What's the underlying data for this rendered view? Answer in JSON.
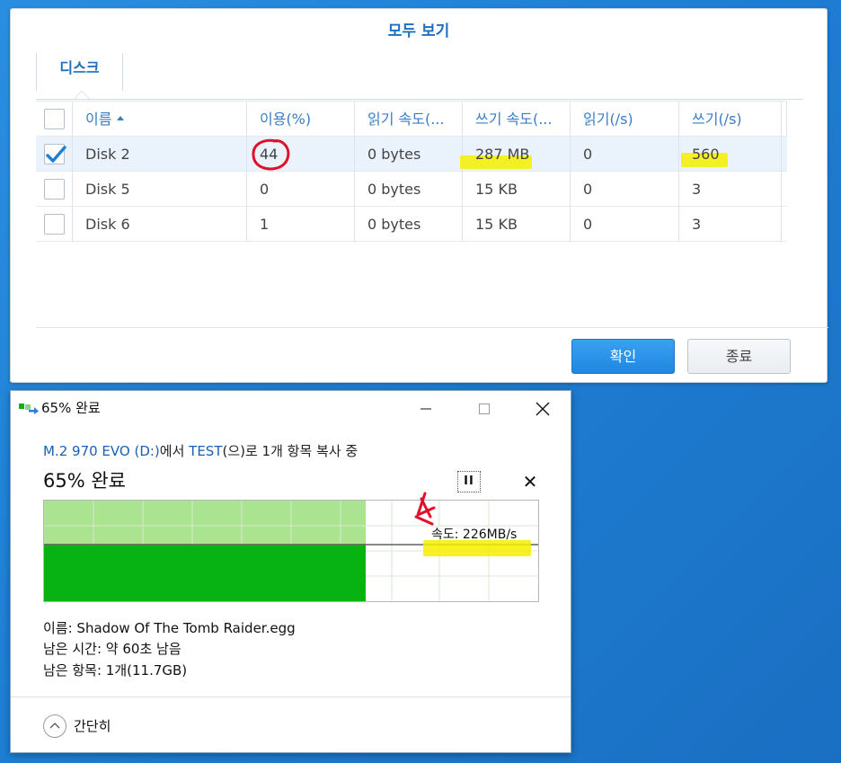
{
  "synology": {
    "title": "모두 보기",
    "tab": "디스크",
    "columns": [
      "이름",
      "이용(%)",
      "읽기 속도(...",
      "쓰기 속도(...",
      "읽기(/s)",
      "쓰기(/s)"
    ],
    "rows": [
      {
        "name": "Disk 2",
        "usage": "44",
        "read_speed": "0 bytes",
        "write_speed": "287 MB",
        "reads": "0",
        "writes": "560",
        "checked": true
      },
      {
        "name": "Disk 5",
        "usage": "0",
        "read_speed": "0 bytes",
        "write_speed": "15 KB",
        "reads": "0",
        "writes": "3",
        "checked": false
      },
      {
        "name": "Disk 6",
        "usage": "1",
        "read_speed": "0 bytes",
        "write_speed": "15 KB",
        "reads": "0",
        "writes": "3",
        "checked": false
      }
    ],
    "ok_label": "확인",
    "close_label": "종료",
    "colors": {
      "accent": "#1c6fc2",
      "button": "#2590e8",
      "highlight": "#f6ee00",
      "annotation": "#e0102a"
    }
  },
  "copy_dialog": {
    "title": "65% 완료",
    "source": "M.2 970 EVO (D:)",
    "source_suffix": "에서 ",
    "dest": "TEST",
    "dest_suffix": "(으)로 1개 항목 복사 중",
    "progress_text": "65% 완료",
    "progress_percent": 65,
    "pause_label": "II",
    "cancel_label": "✕",
    "speed_label": "속도: 226MB/s",
    "name_line": "이름: Shadow Of The Tomb Raider.egg",
    "time_line": "남은 시간: 약 60초 남음",
    "items_line": "남은 항목: 1개(11.7GB)",
    "collapse_label": "간단히",
    "colors": {
      "graph_fill": "#07b312",
      "graph_bg": "#aae491",
      "link": "#1a5fb4"
    }
  }
}
